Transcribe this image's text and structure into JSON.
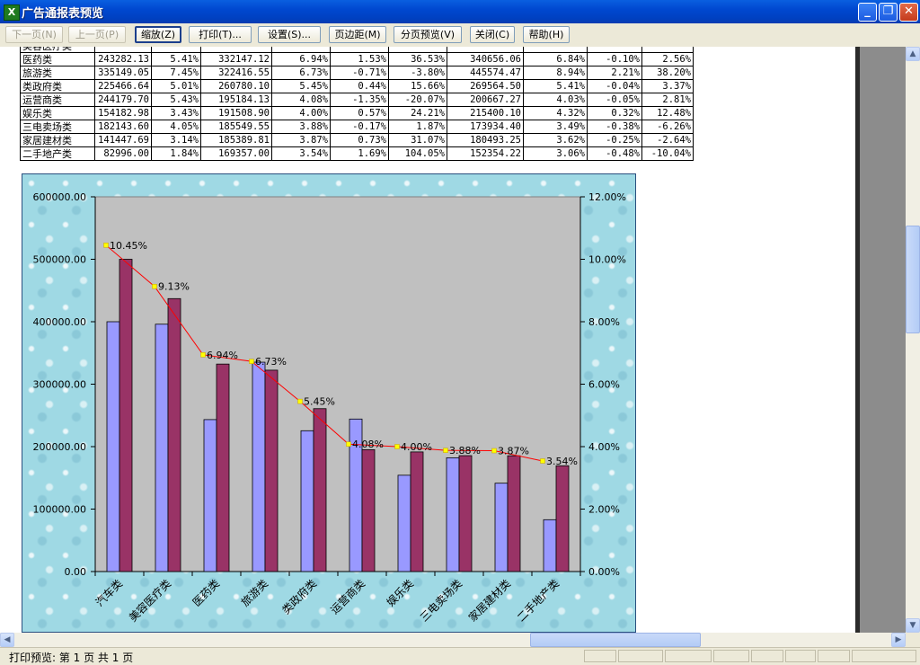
{
  "window": {
    "title": "广告通报表预览"
  },
  "toolbar": {
    "buttons": [
      {
        "label": "下一页(N)",
        "disabled": true
      },
      {
        "label": "上一页(P)",
        "disabled": true
      },
      {
        "label": "缩放(Z)",
        "disabled": false
      },
      {
        "label": "打印(T)...",
        "disabled": false
      },
      {
        "label": "设置(S)...",
        "disabled": false
      },
      {
        "label": "页边距(M)",
        "disabled": false
      },
      {
        "label": "分页预览(V)",
        "disabled": false
      },
      {
        "label": "关闭(C)",
        "disabled": false
      },
      {
        "label": "帮助(H)",
        "disabled": false
      }
    ]
  },
  "table": {
    "rows": [
      [
        "美容医疗类",
        "",
        "",
        "",
        "",
        "",
        "",
        "",
        "",
        ""
      ],
      [
        "医药类",
        "243282.13",
        "5.41%",
        "332147.12",
        "6.94%",
        "1.53%",
        "36.53%",
        "340656.06",
        "6.84%",
        "-0.10%",
        "2.56%"
      ],
      [
        "旅游类",
        "335149.05",
        "7.45%",
        "322416.55",
        "6.73%",
        "-0.71%",
        "-3.80%",
        "445574.47",
        "8.94%",
        "2.21%",
        "38.20%"
      ],
      [
        "类政府类",
        "225466.64",
        "5.01%",
        "260780.10",
        "5.45%",
        "0.44%",
        "15.66%",
        "269564.50",
        "5.41%",
        "-0.04%",
        "3.37%"
      ],
      [
        "运营商类",
        "244179.70",
        "5.43%",
        "195184.13",
        "4.08%",
        "-1.35%",
        "-20.07%",
        "200667.27",
        "4.03%",
        "-0.05%",
        "2.81%"
      ],
      [
        "娱乐类",
        "154182.98",
        "3.43%",
        "191508.90",
        "4.00%",
        "0.57%",
        "24.21%",
        "215400.10",
        "4.32%",
        "0.32%",
        "12.48%"
      ],
      [
        "三电卖场类",
        "182143.60",
        "4.05%",
        "185549.55",
        "3.88%",
        "-0.17%",
        "1.87%",
        "173934.40",
        "3.49%",
        "-0.38%",
        "-6.26%"
      ],
      [
        "家居建材类",
        "141447.69",
        "3.14%",
        "185389.81",
        "3.87%",
        "0.73%",
        "31.07%",
        "180493.25",
        "3.62%",
        "-0.25%",
        "-2.64%"
      ],
      [
        "二手地产类",
        "82996.00",
        "1.84%",
        "169357.00",
        "3.54%",
        "1.69%",
        "104.05%",
        "152354.22",
        "3.06%",
        "-0.48%",
        "-10.04%"
      ]
    ]
  },
  "chart_data": {
    "type": "bar",
    "categories": [
      "汽车类",
      "美容医疗类",
      "医药类",
      "旅游类",
      "类政府类",
      "运营商类",
      "娱乐类",
      "三电卖场类",
      "家居建材类",
      "二手地产类"
    ],
    "series": [
      {
        "type": "bar",
        "axis": "left",
        "color": "#9999ff",
        "values": [
          400000,
          396000,
          243282.13,
          335149.05,
          225466.64,
          244179.7,
          154182.98,
          182143.6,
          141447.69,
          82996.0
        ]
      },
      {
        "type": "bar",
        "axis": "left",
        "color": "#993366",
        "values": [
          500000,
          437000,
          332147.12,
          322416.55,
          260780.1,
          195184.13,
          191508.9,
          185549.55,
          185389.81,
          169357.0
        ]
      },
      {
        "type": "line",
        "axis": "right",
        "color": "#ff0000",
        "marker_color": "#ffff00",
        "values": [
          10.45,
          9.13,
          6.94,
          6.73,
          5.45,
          4.08,
          4.0,
          3.88,
          3.87,
          3.54
        ],
        "labels": [
          "10.45%",
          "9.13%",
          "6.94%",
          "6.73%",
          "5.45%",
          "4.08%",
          "4.00%",
          "3.88%",
          "3.87%",
          "3.54%"
        ]
      }
    ],
    "y_left": {
      "min": 0,
      "max": 600000,
      "ticks": [
        "0.00",
        "100000.00",
        "200000.00",
        "300000.00",
        "400000.00",
        "500000.00",
        "600000.00"
      ]
    },
    "y_right": {
      "min": 0,
      "max": 12,
      "ticks": [
        "0.00%",
        "2.00%",
        "4.00%",
        "6.00%",
        "8.00%",
        "10.00%",
        "12.00%"
      ]
    },
    "plot_background": "#c0c0c0",
    "grid": false,
    "legend": "none"
  },
  "status": {
    "text": "打印预览: 第 1 页  共 1 页"
  }
}
